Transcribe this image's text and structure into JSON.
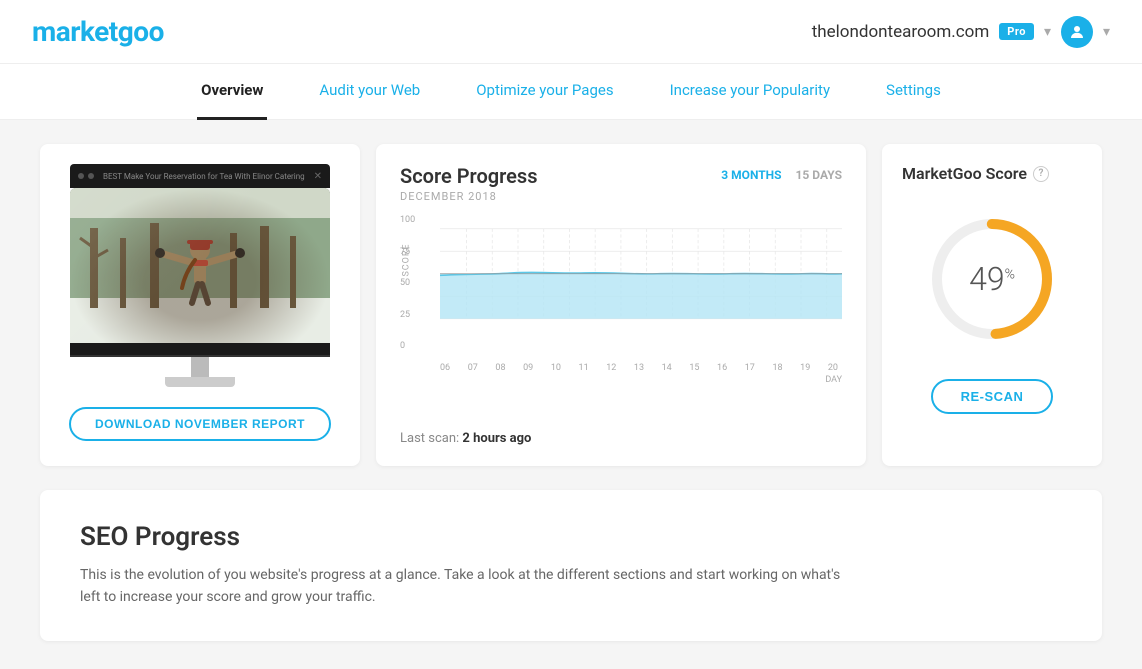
{
  "header": {
    "logo": "marketgoo",
    "domain": "thelondontearoom.com",
    "plan": "Pro",
    "chevron": "▾",
    "avatar_icon": "👤"
  },
  "nav": {
    "items": [
      {
        "label": "Overview",
        "active": true
      },
      {
        "label": "Audit your Web",
        "active": false
      },
      {
        "label": "Optimize your Pages",
        "active": false
      },
      {
        "label": "Increase your Popularity",
        "active": false
      },
      {
        "label": "Settings",
        "active": false
      }
    ]
  },
  "preview_card": {
    "download_button": "DOWNLOAD NOVEMBER REPORT",
    "title_bar_text": "BEST Make Your Reservation for Tea With Elinor Catering"
  },
  "score_card": {
    "title": "Score Progress",
    "month": "DECEMBER 2018",
    "period_options": [
      "3 MONTHS",
      "15 DAYS"
    ],
    "active_period": "3 MONTHS",
    "y_axis_label": "SCORE",
    "y_labels": [
      "100",
      "75",
      "50",
      "25",
      "0"
    ],
    "x_labels": [
      "06",
      "07",
      "08",
      "09",
      "10",
      "11",
      "12",
      "13",
      "14",
      "15",
      "16",
      "17",
      "18",
      "19",
      "20"
    ],
    "x_axis_label": "DAY",
    "last_scan_prefix": "Last scan: ",
    "last_scan_time": "2 hours ago"
  },
  "marketgoo_score": {
    "title": "MarketGoo Score",
    "score": "49",
    "unit": "%",
    "rescan_button": "RE-SCAN",
    "score_percent": 49,
    "track_color": "#eee",
    "fill_color": "#f5a623"
  },
  "seo_progress": {
    "title": "SEO Progress",
    "description": "This is the evolution of you website's progress at a glance. Take a look at the different sections and start working on what's left to increase your score and grow your traffic."
  }
}
